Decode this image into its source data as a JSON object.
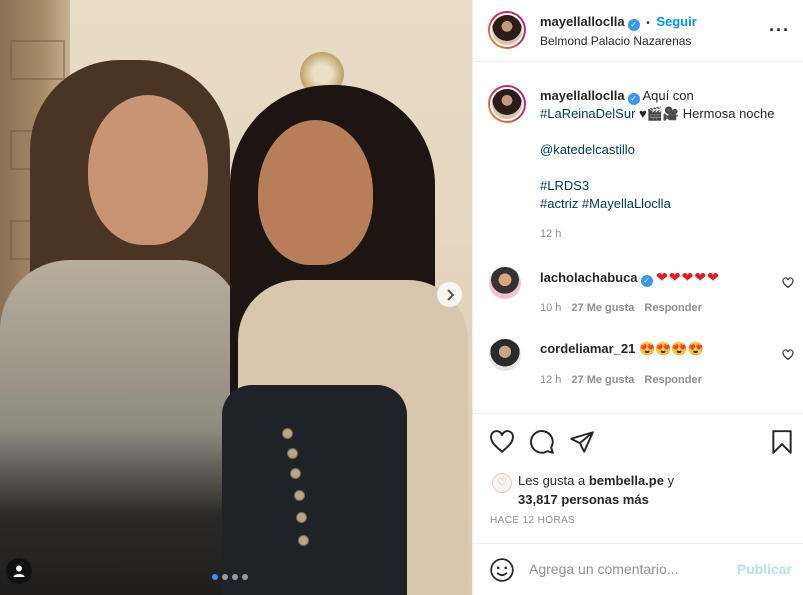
{
  "post": {
    "username": "mayellalloclla",
    "verified": true,
    "follow_label": "Seguir",
    "separator": "•",
    "location": "Belmond Palacio Nazarenas",
    "more_icon": "more-options-icon",
    "carousel": {
      "current": 1,
      "total": 4
    }
  },
  "caption": {
    "username": "mayellalloclla",
    "text_1": " Aquí con",
    "hashtag_1": "#LaReinaDelSur",
    "text_2": " ♥🎬🎥 Hermosa noche",
    "mention": "@katedelcastillo",
    "hashtag_2": "#LRDS3",
    "hashtag_3": "#actriz",
    "hashtag_4": "#MayellaLloclla",
    "time": "12 h"
  },
  "comments": [
    {
      "username": "lacholachabuca",
      "verified": true,
      "text": "❤❤❤❤❤",
      "time": "10 h",
      "likes": "27 Me gusta",
      "reply": "Responder"
    },
    {
      "username": "cordeliamar_21",
      "verified": false,
      "text": "😍😍😍😍",
      "time": "12 h",
      "likes": "27 Me gusta",
      "reply": "Responder"
    }
  ],
  "likes": {
    "prefix": "Les gusta a ",
    "user": "bembella.pe",
    "middle": " y",
    "count": "33,817 personas más"
  },
  "time_ago": "HACE 12 HORAS",
  "add_comment": {
    "placeholder": "Agrega un comentario...",
    "publish_label": "Publicar"
  },
  "colors": {
    "link_blue": "#0095f6",
    "hashtag_blue": "#00376b",
    "muted": "#8e8e8e",
    "publish_disabled": "#b2dffc"
  }
}
